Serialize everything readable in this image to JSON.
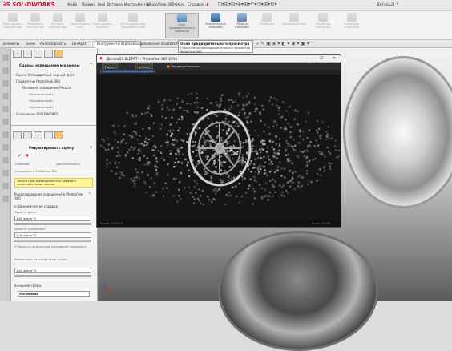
{
  "app": {
    "logo_text": "SOLIDWORKS",
    "document_title": "Деталь21 *"
  },
  "menu": [
    "Файл",
    "Правка",
    "Вид",
    "Вставка",
    "Инструменты",
    "PhotoView 360",
    "Окно",
    "Справка"
  ],
  "ribbon": {
    "buttons": [
      {
        "label": "Редактировать внешний вид",
        "state": "dim"
      },
      {
        "label": "Копировать внешний вид",
        "state": "dim"
      },
      {
        "label": "Вставить внешний вид",
        "state": "dim"
      },
      {
        "label": "Редактировать сцену",
        "state": "dim"
      },
      {
        "label": "Редактировать наклейку",
        "state": "dim"
      },
      {
        "label": "Интегрированный предварительный",
        "state": "dim"
      },
      {
        "label": "Окно предварительного просмотра",
        "state": "active"
      },
      {
        "label": "Окончательная отрисовка",
        "state": "normal"
      },
      {
        "label": "Область отрисовки",
        "state": "normal"
      },
      {
        "label": "Параметры",
        "state": "dim"
      },
      {
        "label": "Запланированная",
        "state": "dim"
      },
      {
        "label": "Параметры просмотра",
        "state": "dim"
      },
      {
        "label": "Последняя отрисовка",
        "state": "dim"
      }
    ]
  },
  "tabs": [
    "Элементы",
    "Эскиз",
    "Анализировать",
    "DimXpert",
    "Инструменты отрисовки",
    "Добавления SOLIDWORKS"
  ],
  "selected_tab": 4,
  "tooltip": {
    "title": "Окно предварительного просмотра",
    "text": "Открытие окна предварительного просмотра PhotoView 360"
  },
  "panel": {
    "top_section_title": "Сцены, освещение и камеры",
    "tree": [
      "Сцена (Стандартный черный фон)",
      "Параметры PhotoView 360",
      "Основное освещение PhotoV",
      "Направленный1",
      "Направленный2",
      "Направленный3",
      "Освещение SOLIDWORKS"
    ],
    "edit_title": "Редактировать сцену",
    "subtabs": [
      "Основной",
      "Дополнительно"
    ],
    "section_label": "Освещение в PhotoView 360",
    "hint": "Запуск при необходимости в добавить дополнительные панели.",
    "group1": "Редактирование освещения в PhotoView 360",
    "checkbox1": "Динамическая справка",
    "field1_label": "Яркость фона:",
    "field1_value": "1.60 w/srm^2",
    "field2_label": "Яркость отражения:",
    "field2_value": "1.00 w/srm^2",
    "checkbox2": "Яркость загрузочных отражений (задержка)",
    "field3_label": "Управление интенсив-стью сцены:",
    "field3_value": "1.40 w/srm^2",
    "group2": "Внешние среды",
    "select_value": "Отключено"
  },
  "pv_window": {
    "title": "Деталь21.SLDPRT* - PhotoView 360 2016",
    "toolbar": [
      "Пауза",
      "Стоп",
      "Предварительная..."
    ],
    "subbar": "Сохранить изображение в файле",
    "status_left": "Время: 00:00:03",
    "status_right": "Кадр: 15/256"
  },
  "colors": {
    "brand": "#c8102e",
    "accent_orange": "#f29400",
    "hint_yellow": "#fff79a"
  }
}
